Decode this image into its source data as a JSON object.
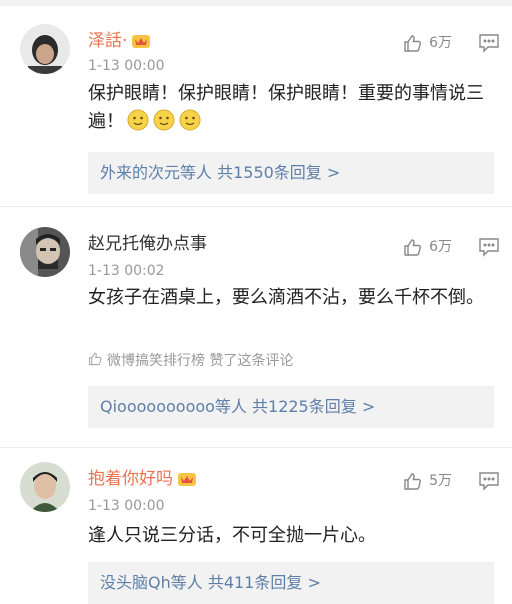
{
  "comments": [
    {
      "username": "泽話·",
      "time": "1-13 00:00",
      "text": "保护眼睛！保护眼睛！保护眼睛！重要的事情说三遍！",
      "likes": "6万",
      "reply_summary": "外来的次元等人 共1550条回复 >"
    },
    {
      "username": "赵兄托俺办点事",
      "time": "1-13 00:02",
      "text": "女孩子在酒桌上，要么滴酒不沾，要么千杯不倒。",
      "likes": "6万",
      "liked_by": "微博搞笑排行榜 赞了这条评论",
      "reply_summary": "Qioooooooooo等人 共1225条回复 >"
    },
    {
      "username": "抱着你好吗",
      "time": "1-13 00:00",
      "text": "逢人只说三分话，不可全抛一片心。",
      "likes": "5万",
      "reply_summary": "没头脑Qh等人 共411条回复 >"
    }
  ],
  "colors": {
    "username_accent": "#eb7350",
    "link_blue": "#5d7fa8",
    "muted_gray": "#999999",
    "reply_bg": "#f2f2f2"
  },
  "icons": [
    "thumbs-up-icon",
    "reply-comment-icon",
    "vip-crown-icon",
    "smile-emoji-icon"
  ]
}
